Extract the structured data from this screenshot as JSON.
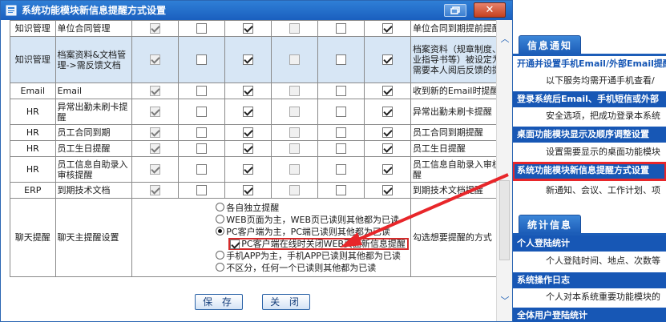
{
  "dialog": {
    "title": "系统功能模块新信息提醒方式设置",
    "close_glyph": "✕",
    "save_label": "保 存",
    "close_label": "关 闭"
  },
  "rows": [
    {
      "category": "知识管理",
      "name": "单位合同管理",
      "checks": [
        true,
        false,
        true,
        false,
        false,
        true
      ],
      "disabled": [
        true,
        false,
        false,
        true,
        false,
        false
      ],
      "remark": "单位合同到期提前提醒",
      "shade": false
    },
    {
      "category": "知识管理",
      "name": "档案资料&文档管理->需反馈文档",
      "checks": [
        true,
        false,
        true,
        false,
        false,
        true
      ],
      "disabled": [
        true,
        false,
        false,
        true,
        false,
        false
      ],
      "remark": "档案资料（规章制度、作业指导书等）被设定为了需要本人阅后反馈的提醒",
      "shade": true
    },
    {
      "category": "Email",
      "name": "Email",
      "checks": [
        true,
        false,
        true,
        false,
        false,
        true
      ],
      "disabled": [
        true,
        false,
        false,
        true,
        false,
        false
      ],
      "remark": "收到新的Email时提醒",
      "shade": false
    },
    {
      "category": "HR",
      "name": "异常出勤未刷卡提醒",
      "checks": [
        true,
        false,
        true,
        false,
        false,
        true
      ],
      "disabled": [
        true,
        false,
        false,
        true,
        false,
        false
      ],
      "remark": "异常出勤未刷卡提醒",
      "shade": false
    },
    {
      "category": "HR",
      "name": "员工合同到期",
      "checks": [
        true,
        false,
        true,
        false,
        false,
        true
      ],
      "disabled": [
        true,
        false,
        false,
        true,
        false,
        false
      ],
      "remark": "员工合同到期提醒",
      "shade": false
    },
    {
      "category": "HR",
      "name": "员工生日提醒",
      "checks": [
        true,
        false,
        true,
        false,
        false,
        true
      ],
      "disabled": [
        true,
        false,
        false,
        true,
        false,
        false
      ],
      "remark": "员工生日提醒",
      "shade": false
    },
    {
      "category": "HR",
      "name": "员工信息自助录入审核提醒",
      "checks": [
        true,
        false,
        true,
        false,
        false,
        true
      ],
      "disabled": [
        true,
        false,
        false,
        true,
        false,
        false
      ],
      "remark": "员工信息自助录入审核提醒",
      "shade": false
    },
    {
      "category": "ERP",
      "name": "到期技术文档",
      "checks": [
        true,
        false,
        true,
        false,
        false,
        true
      ],
      "disabled": [
        true,
        false,
        false,
        true,
        false,
        false
      ],
      "remark": "到期技术文档提醒",
      "shade": false
    }
  ],
  "chat": {
    "category": "聊天提醒",
    "name": "聊天主提醒设置",
    "remark": "勾选想要提醒的方式",
    "options": [
      {
        "label": "各自独立提醒",
        "selected": false
      },
      {
        "label": "WEB页面为主，WEB页已读则其他都为已读",
        "selected": false
      },
      {
        "label": "PC客户端为主，PC端已读则其他都为已读",
        "selected": true
      },
      {
        "label": "手机APP为主，手机APP已读则其他都为已读",
        "selected": false
      },
      {
        "label": "不区分，任何一个已读则其他都为已读",
        "selected": false
      }
    ],
    "sub_option": {
      "label": "PC客户端在线时关闭WEB页面新信息提醒",
      "checked": true
    }
  },
  "background": {
    "sections": [
      {
        "tab": "信息通知",
        "items": [
          {
            "head": "开通并设置手机Email/外部Email提醒",
            "style": "plain",
            "sub": "以下服务均需开通手机查看/"
          },
          {
            "head": "登录系统后Email、手机短信或外部",
            "style": "blue",
            "sub": "安全选项，把成功登录本系统"
          },
          {
            "head": "桌面功能模块显示及顺序调整设置",
            "style": "blue",
            "sub": "设置需要显示的桌面功能模块"
          },
          {
            "head": "系统功能模块新信息提醒方式设置",
            "style": "highlight",
            "sub": "新通知、会议、工作计划、项"
          }
        ]
      },
      {
        "tab": "统计信息",
        "items": [
          {
            "head": "个人登陆统计",
            "style": "blue",
            "sub": "个人登陆时间、地点、次数等"
          },
          {
            "head": "系统操作日志",
            "style": "blue",
            "sub": "个人对本系统重要功能模块的"
          },
          {
            "head": "全体用户登陆统计",
            "style": "blue",
            "sub": ""
          }
        ]
      }
    ]
  },
  "colors": {
    "title_bar": "#1a5fbf",
    "section_blue": "#1757b5",
    "highlight_red": "#e8262a",
    "row_shade": "#d7e6f5"
  }
}
